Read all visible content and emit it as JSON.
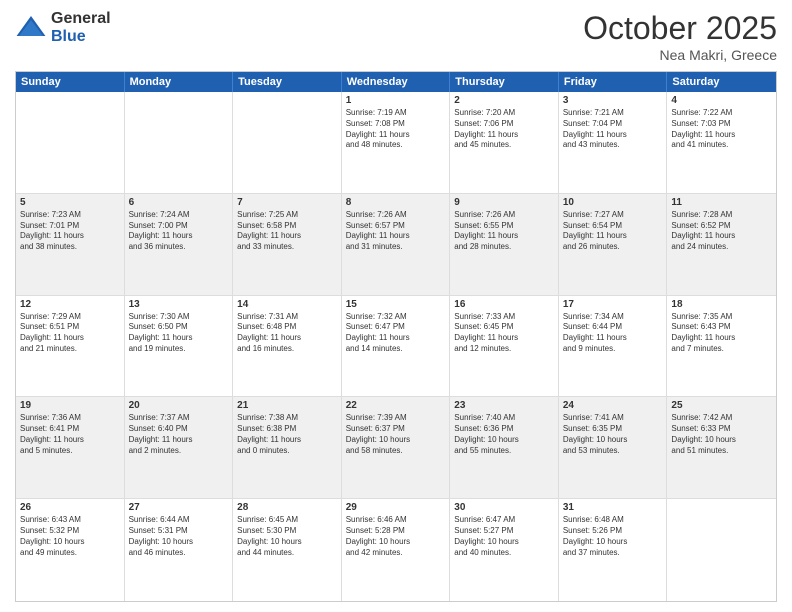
{
  "logo": {
    "general": "General",
    "blue": "Blue"
  },
  "header": {
    "month": "October 2025",
    "location": "Nea Makri, Greece"
  },
  "weekdays": [
    "Sunday",
    "Monday",
    "Tuesday",
    "Wednesday",
    "Thursday",
    "Friday",
    "Saturday"
  ],
  "rows": [
    [
      {
        "day": "",
        "info": ""
      },
      {
        "day": "",
        "info": ""
      },
      {
        "day": "",
        "info": ""
      },
      {
        "day": "1",
        "info": "Sunrise: 7:19 AM\nSunset: 7:08 PM\nDaylight: 11 hours\nand 48 minutes."
      },
      {
        "day": "2",
        "info": "Sunrise: 7:20 AM\nSunset: 7:06 PM\nDaylight: 11 hours\nand 45 minutes."
      },
      {
        "day": "3",
        "info": "Sunrise: 7:21 AM\nSunset: 7:04 PM\nDaylight: 11 hours\nand 43 minutes."
      },
      {
        "day": "4",
        "info": "Sunrise: 7:22 AM\nSunset: 7:03 PM\nDaylight: 11 hours\nand 41 minutes."
      }
    ],
    [
      {
        "day": "5",
        "info": "Sunrise: 7:23 AM\nSunset: 7:01 PM\nDaylight: 11 hours\nand 38 minutes."
      },
      {
        "day": "6",
        "info": "Sunrise: 7:24 AM\nSunset: 7:00 PM\nDaylight: 11 hours\nand 36 minutes."
      },
      {
        "day": "7",
        "info": "Sunrise: 7:25 AM\nSunset: 6:58 PM\nDaylight: 11 hours\nand 33 minutes."
      },
      {
        "day": "8",
        "info": "Sunrise: 7:26 AM\nSunset: 6:57 PM\nDaylight: 11 hours\nand 31 minutes."
      },
      {
        "day": "9",
        "info": "Sunrise: 7:26 AM\nSunset: 6:55 PM\nDaylight: 11 hours\nand 28 minutes."
      },
      {
        "day": "10",
        "info": "Sunrise: 7:27 AM\nSunset: 6:54 PM\nDaylight: 11 hours\nand 26 minutes."
      },
      {
        "day": "11",
        "info": "Sunrise: 7:28 AM\nSunset: 6:52 PM\nDaylight: 11 hours\nand 24 minutes."
      }
    ],
    [
      {
        "day": "12",
        "info": "Sunrise: 7:29 AM\nSunset: 6:51 PM\nDaylight: 11 hours\nand 21 minutes."
      },
      {
        "day": "13",
        "info": "Sunrise: 7:30 AM\nSunset: 6:50 PM\nDaylight: 11 hours\nand 19 minutes."
      },
      {
        "day": "14",
        "info": "Sunrise: 7:31 AM\nSunset: 6:48 PM\nDaylight: 11 hours\nand 16 minutes."
      },
      {
        "day": "15",
        "info": "Sunrise: 7:32 AM\nSunset: 6:47 PM\nDaylight: 11 hours\nand 14 minutes."
      },
      {
        "day": "16",
        "info": "Sunrise: 7:33 AM\nSunset: 6:45 PM\nDaylight: 11 hours\nand 12 minutes."
      },
      {
        "day": "17",
        "info": "Sunrise: 7:34 AM\nSunset: 6:44 PM\nDaylight: 11 hours\nand 9 minutes."
      },
      {
        "day": "18",
        "info": "Sunrise: 7:35 AM\nSunset: 6:43 PM\nDaylight: 11 hours\nand 7 minutes."
      }
    ],
    [
      {
        "day": "19",
        "info": "Sunrise: 7:36 AM\nSunset: 6:41 PM\nDaylight: 11 hours\nand 5 minutes."
      },
      {
        "day": "20",
        "info": "Sunrise: 7:37 AM\nSunset: 6:40 PM\nDaylight: 11 hours\nand 2 minutes."
      },
      {
        "day": "21",
        "info": "Sunrise: 7:38 AM\nSunset: 6:38 PM\nDaylight: 11 hours\nand 0 minutes."
      },
      {
        "day": "22",
        "info": "Sunrise: 7:39 AM\nSunset: 6:37 PM\nDaylight: 10 hours\nand 58 minutes."
      },
      {
        "day": "23",
        "info": "Sunrise: 7:40 AM\nSunset: 6:36 PM\nDaylight: 10 hours\nand 55 minutes."
      },
      {
        "day": "24",
        "info": "Sunrise: 7:41 AM\nSunset: 6:35 PM\nDaylight: 10 hours\nand 53 minutes."
      },
      {
        "day": "25",
        "info": "Sunrise: 7:42 AM\nSunset: 6:33 PM\nDaylight: 10 hours\nand 51 minutes."
      }
    ],
    [
      {
        "day": "26",
        "info": "Sunrise: 6:43 AM\nSunset: 5:32 PM\nDaylight: 10 hours\nand 49 minutes."
      },
      {
        "day": "27",
        "info": "Sunrise: 6:44 AM\nSunset: 5:31 PM\nDaylight: 10 hours\nand 46 minutes."
      },
      {
        "day": "28",
        "info": "Sunrise: 6:45 AM\nSunset: 5:30 PM\nDaylight: 10 hours\nand 44 minutes."
      },
      {
        "day": "29",
        "info": "Sunrise: 6:46 AM\nSunset: 5:28 PM\nDaylight: 10 hours\nand 42 minutes."
      },
      {
        "day": "30",
        "info": "Sunrise: 6:47 AM\nSunset: 5:27 PM\nDaylight: 10 hours\nand 40 minutes."
      },
      {
        "day": "31",
        "info": "Sunrise: 6:48 AM\nSunset: 5:26 PM\nDaylight: 10 hours\nand 37 minutes."
      },
      {
        "day": "",
        "info": ""
      }
    ]
  ],
  "shaded_rows": [
    1,
    3
  ]
}
